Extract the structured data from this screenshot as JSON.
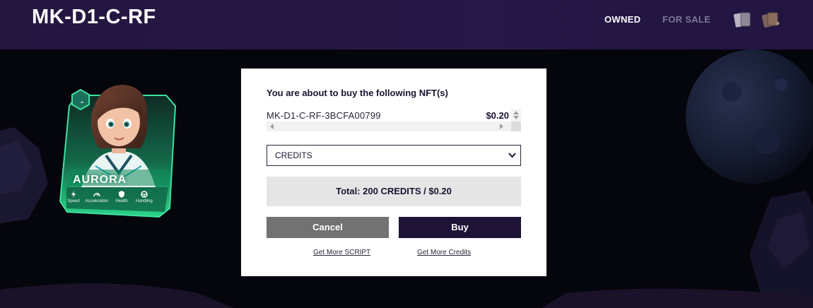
{
  "header": {
    "title": "MK-D1-C-RF",
    "nav": {
      "owned": "OWNED",
      "for_sale": "FOR SALE"
    },
    "icons": [
      "cards-icon",
      "card-pack-icon"
    ]
  },
  "character_card": {
    "name": "AURORA",
    "badge": "-",
    "stats": [
      "Speed",
      "Acceleration",
      "Health",
      "Handling"
    ]
  },
  "modal": {
    "heading": "You are about to buy the following NFT(s)",
    "items": [
      {
        "name": "MK-D1-C-RF-3BCFA00799",
        "price": "$0.20"
      }
    ],
    "currency": {
      "selected": "CREDITS"
    },
    "total": "Total: 200 CREDITS / $0.20",
    "cancel_label": "Cancel",
    "buy_label": "Buy",
    "links": {
      "script": "Get More SCRIPT",
      "credits": "Get More Credits"
    }
  },
  "colors": {
    "header_bg": "#24163f",
    "accent_dark": "#1e1236",
    "cancel_gray": "#727272",
    "card_green": "#2bd58a"
  }
}
